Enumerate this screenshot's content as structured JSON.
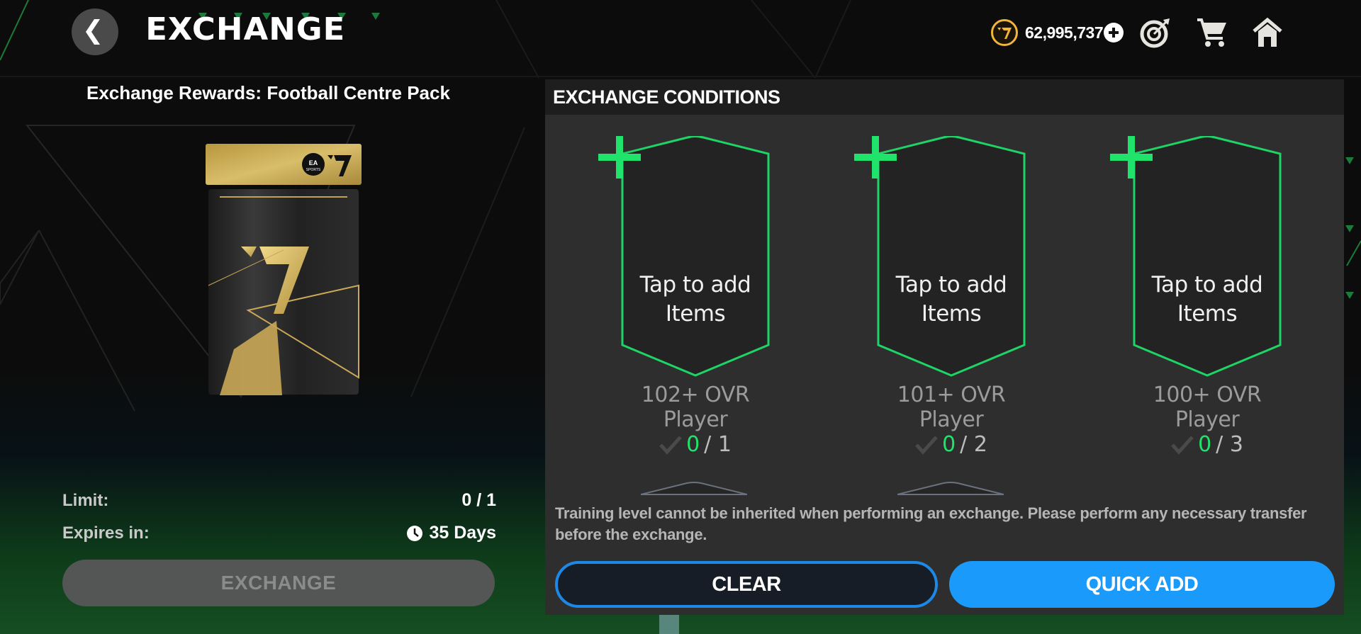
{
  "header": {
    "title": "EXCHANGE",
    "back_icon": "chevron-left-icon",
    "currency": {
      "icon": "fc-points-coin-icon",
      "amount": "62,995,737",
      "add_icon": "plus-circle-icon"
    },
    "actions": [
      {
        "name": "objectives",
        "icon": "target-icon"
      },
      {
        "name": "store",
        "icon": "cart-icon"
      },
      {
        "name": "home",
        "icon": "home-icon"
      }
    ]
  },
  "rewards": {
    "label": "Exchange Rewards:  Football Centre Pack",
    "pack_image": "football-centre-pack",
    "limit_label": "Limit:",
    "limit_value": "0 / 1",
    "expires_label": "Expires in:",
    "expires_icon": "clock-icon",
    "expires_value": "35 Days",
    "exchange_button": "EXCHANGE"
  },
  "conditions": {
    "title": "EXCHANGE CONDITIONS",
    "slots": [
      {
        "cta": "Tap to add Items",
        "requirement": "102+ OVR Player",
        "current": "0",
        "required": "/ 1"
      },
      {
        "cta": "Tap to add Items",
        "requirement": "101+ OVR Player",
        "current": "0",
        "required": "/ 2"
      },
      {
        "cta": "Tap to add Items",
        "requirement": "100+ OVR Player",
        "current": "0",
        "required": "/ 3"
      }
    ],
    "notice": "Training level cannot be inherited when performing an exchange. Please perform any necessary transfer before the exchange.",
    "clear_button": "CLEAR",
    "quick_add_button": "QUICK ADD"
  },
  "colors": {
    "accent_green": "#20e36c",
    "primary_blue": "#1a9bfc",
    "coin_gold": "#f2b53a",
    "panel_bg": "#2e2e2e",
    "disabled_button": "#545555"
  }
}
